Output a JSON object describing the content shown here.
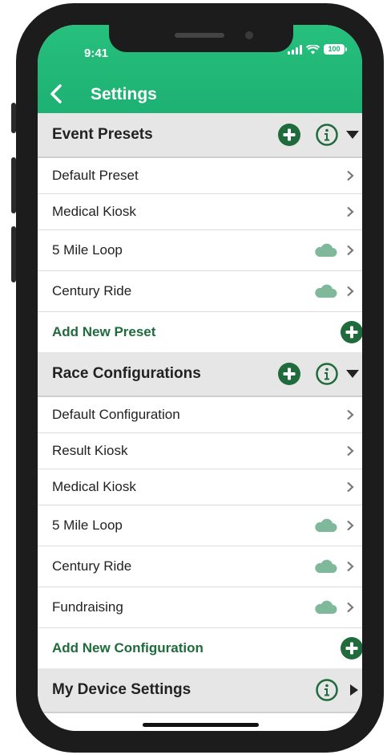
{
  "status_bar": {
    "time": "9:41",
    "battery": "100"
  },
  "nav": {
    "title": "Settings"
  },
  "event_presets": {
    "title": "Event Presets",
    "items": [
      {
        "label": "Default Preset",
        "cloud": false
      },
      {
        "label": "Medical Kiosk",
        "cloud": false
      },
      {
        "label": "5 Mile Loop",
        "cloud": true
      },
      {
        "label": "Century Ride",
        "cloud": true
      }
    ],
    "add_label": "Add New Preset"
  },
  "race_configurations": {
    "title": "Race Configurations",
    "items": [
      {
        "label": "Default Configuration",
        "cloud": false
      },
      {
        "label": "Result Kiosk",
        "cloud": false
      },
      {
        "label": "Medical Kiosk",
        "cloud": false
      },
      {
        "label": "5 Mile Loop",
        "cloud": true
      },
      {
        "label": "Century Ride",
        "cloud": true
      },
      {
        "label": "Fundraising",
        "cloud": true
      }
    ],
    "add_label": "Add New Configuration"
  },
  "my_device_settings": {
    "title": "My Device Settings"
  },
  "colors": {
    "header_green": "#1db173",
    "dark_green": "#1f6b3b",
    "cloud": "#7fb89a"
  },
  "icons": {
    "back": "chevron-left-icon",
    "add": "plus-circle-icon",
    "info": "info-circle-icon",
    "expand": "caret-down-icon",
    "collapsed": "caret-right-icon",
    "cloud": "cloud-icon",
    "row": "chevron-right-icon"
  }
}
